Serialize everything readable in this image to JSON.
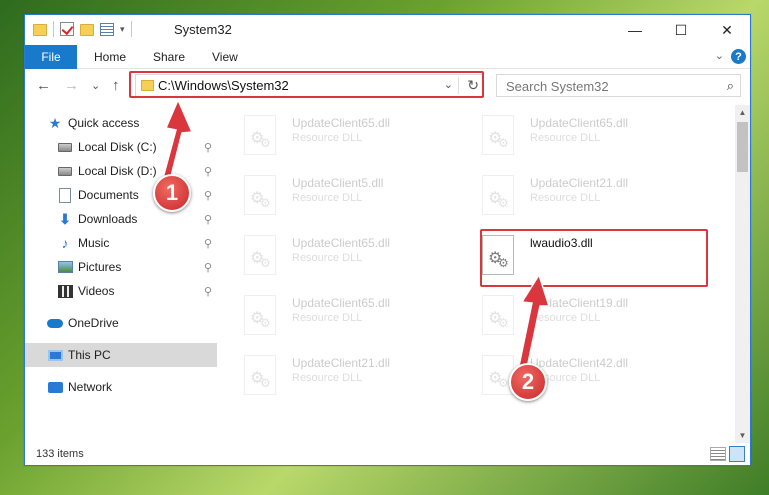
{
  "window": {
    "title": "System32",
    "minimize_glyph": "—",
    "maximize_glyph": "☐",
    "close_glyph": "✕"
  },
  "ribbon": {
    "tabs": [
      "File",
      "Home",
      "Share",
      "View"
    ],
    "collapse_glyph": "⌄",
    "help_glyph": "?"
  },
  "nav": {
    "back_glyph": "←",
    "forward_glyph": "→",
    "recent_glyph": "⌄",
    "up_glyph": "↑"
  },
  "address": {
    "path": "C:\\Windows\\System32",
    "dropdown_glyph": "⌄",
    "refresh_glyph": "↻"
  },
  "search": {
    "placeholder": "Search System32",
    "icon": "search-icon",
    "glyph": "⌕"
  },
  "sidebar": {
    "items": [
      {
        "label": "Quick access",
        "icon": "star-icon",
        "pinned": false
      },
      {
        "label": "Local Disk (C:)",
        "icon": "drive-icon",
        "pinned": true
      },
      {
        "label": "Local Disk (D:)",
        "icon": "drive-icon",
        "pinned": true
      },
      {
        "label": "Documents",
        "icon": "documents-icon",
        "pinned": true
      },
      {
        "label": "Downloads",
        "icon": "downloads-icon",
        "pinned": true
      },
      {
        "label": "Music",
        "icon": "music-icon",
        "pinned": true
      },
      {
        "label": "Pictures",
        "icon": "pictures-icon",
        "pinned": true
      },
      {
        "label": "Videos",
        "icon": "videos-icon",
        "pinned": true
      },
      {
        "label": "OneDrive",
        "icon": "onedrive-icon",
        "pinned": false
      },
      {
        "label": "This PC",
        "icon": "this-pc-icon",
        "pinned": false,
        "selected": true
      },
      {
        "label": "Network",
        "icon": "network-icon",
        "pinned": false
      }
    ],
    "pin_glyph": "📌"
  },
  "files": [
    {
      "name": "UpdateClient65.dll",
      "type": "Resource DLL",
      "faded": true
    },
    {
      "name": "UpdateClient65.dll",
      "type": "Resource DLL",
      "faded": true
    },
    {
      "name": "UpdateClient5.dll",
      "type": "Resource DLL",
      "faded": true
    },
    {
      "name": "UpdateClient21.dll",
      "type": "Resource DLL",
      "faded": true
    },
    {
      "name": "UpdateClient65.dll",
      "type": "Resource DLL",
      "faded": true
    },
    {
      "name": "lwaudio3.dll",
      "type": "",
      "faded": false
    },
    {
      "name": "UpdateClient65.dll",
      "type": "Resource DLL",
      "faded": true
    },
    {
      "name": "UpdateClient19.dll",
      "type": "Resource DLL",
      "faded": true
    },
    {
      "name": "UpdateClient21.dll",
      "type": "Resource DLL",
      "faded": true
    },
    {
      "name": "UpdateClient42.dll",
      "type": "Resource DLL",
      "faded": true
    }
  ],
  "status": {
    "item_count": "133 items"
  },
  "annotations": {
    "step1": "1",
    "step2": "2",
    "color": "#d9363e"
  }
}
